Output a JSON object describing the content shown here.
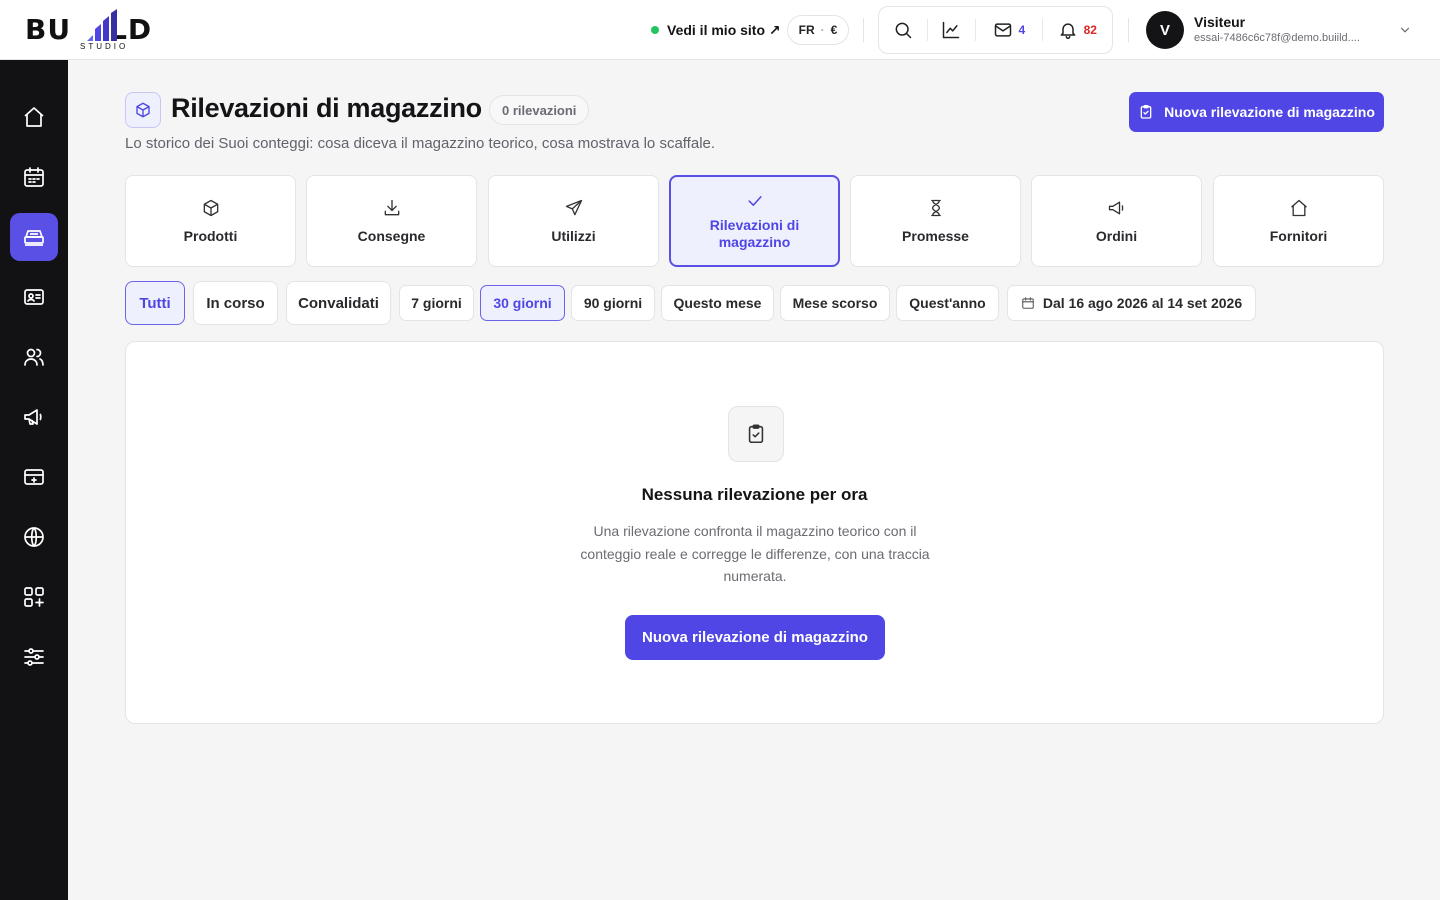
{
  "brand": {
    "logo_left": "BU",
    "logo_right": "LD",
    "logo_sub": "STUDIO"
  },
  "header": {
    "site_link": "Vedi il mio sito ↗",
    "lang": "FR",
    "currency_sep": "·",
    "currency": "€",
    "messages_count": "4",
    "notifications_count": "82",
    "user": {
      "initial": "V",
      "name": "Visiteur",
      "email": "essai-7486c6c78f@demo.buiild...."
    }
  },
  "page": {
    "title": "Rilevazioni di magazzino",
    "count_badge": "0 rilevazioni",
    "subtitle": "Lo storico dei Suoi conteggi: cosa diceva il magazzino teorico, cosa mostrava lo scaffale.",
    "new_button": "Nuova rilevazione di magazzino"
  },
  "tabs": [
    {
      "label": "Prodotti",
      "icon": "box-icon"
    },
    {
      "label": "Consegne",
      "icon": "download-icon"
    },
    {
      "label": "Utilizzi",
      "icon": "send-icon"
    },
    {
      "label": "Rilevazioni di magazzino",
      "icon": "check-icon",
      "active": true
    },
    {
      "label": "Promesse",
      "icon": "hourglass-icon"
    },
    {
      "label": "Ordini",
      "icon": "megaphone-icon"
    },
    {
      "label": "Fornitori",
      "icon": "house-icon"
    }
  ],
  "status_filters": [
    {
      "label": "Tutti",
      "active": true
    },
    {
      "label": "In corso"
    },
    {
      "label": "Convalidati"
    }
  ],
  "period_filters": [
    {
      "label": "7 giorni"
    },
    {
      "label": "30 giorni",
      "active": true
    },
    {
      "label": "90 giorni"
    },
    {
      "label": "Questo mese"
    },
    {
      "label": "Mese scorso"
    },
    {
      "label": "Quest'anno"
    }
  ],
  "date_range": "Dal 16 ago 2026 al 14 set 2026",
  "empty_state": {
    "title": "Nessuna rilevazione per ora",
    "description": "Una rilevazione confronta il magazzino teorico con il conteggio reale e corregge le differenze, con una traccia numerata.",
    "button": "Nuova rilevazione di magazzino"
  },
  "sidebar_icons": [
    "home-icon",
    "calendar-icon",
    "register-icon",
    "contact-card-icon",
    "users-icon",
    "megaphone-icon",
    "payment-card-icon",
    "globe-icon",
    "apps-add-icon",
    "sliders-icon"
  ],
  "colors": {
    "accent": "#4f46e5",
    "sidebar_active": "#5b50e6",
    "status_online": "#22c55e",
    "notification_red": "#dc2626"
  }
}
